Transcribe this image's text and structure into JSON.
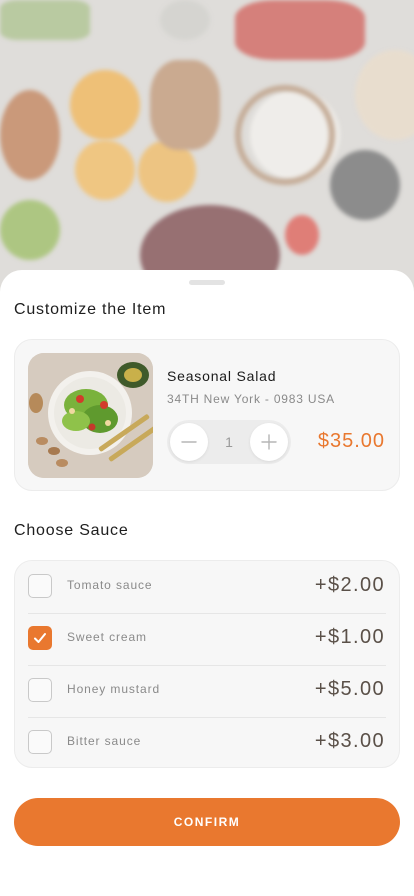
{
  "header": {
    "title": "Customize the Item"
  },
  "item": {
    "name": "Seasonal Salad",
    "address": "34TH New York - 0983 USA",
    "quantity": "1",
    "price": "$35.00",
    "image_icon": "salad-photo"
  },
  "sauces": {
    "title": "Choose Sauce",
    "items": [
      {
        "name": "Tomato sauce",
        "price": "+$2.00",
        "checked": false
      },
      {
        "name": "Sweet cream",
        "price": "+$1.00",
        "checked": true
      },
      {
        "name": "Honey mustard",
        "price": "+$5.00",
        "checked": false
      },
      {
        "name": "Bitter sauce",
        "price": "+$3.00",
        "checked": false
      }
    ]
  },
  "footer": {
    "confirm_label": "CONFIRM"
  },
  "colors": {
    "accent": "#e9782f",
    "card_bg": "#f7f7f7"
  }
}
